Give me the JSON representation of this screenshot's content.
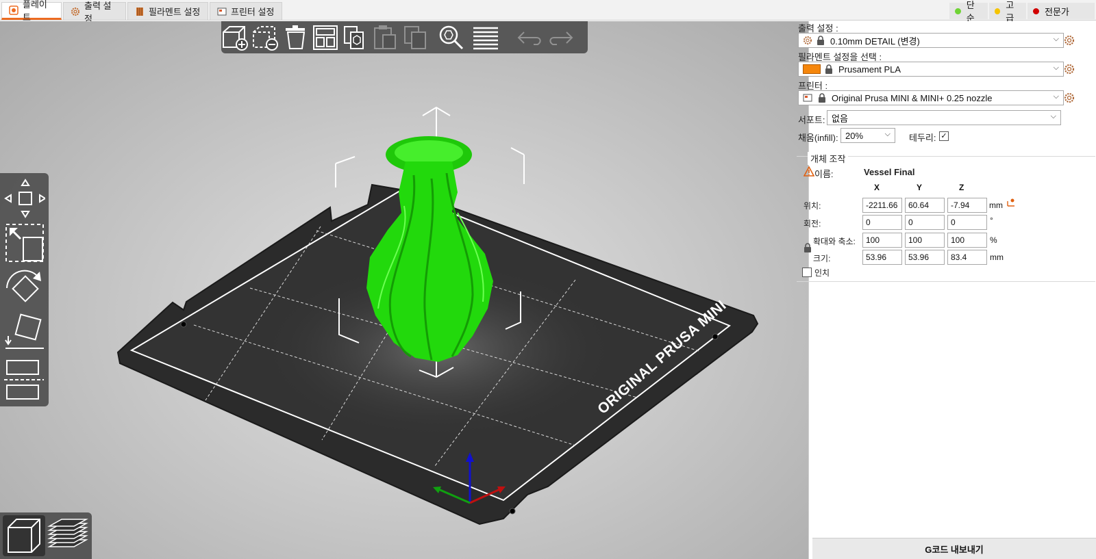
{
  "tabs": [
    {
      "label": "플레이트",
      "icon": "plater-icon"
    },
    {
      "label": "출력 설정",
      "icon": "print-settings-gear-icon"
    },
    {
      "label": "필라멘트 설정",
      "icon": "filament-spool-icon"
    },
    {
      "label": "프린터 설정",
      "icon": "printer-icon"
    }
  ],
  "modes": [
    {
      "label": "단순",
      "color": "#6fd334"
    },
    {
      "label": "고급",
      "color": "#f5c400"
    },
    {
      "label": "전문가",
      "color": "#d10000"
    }
  ],
  "bed": {
    "brand_text": "ORIGINAL PRUSA MINI"
  },
  "object": {
    "color": "#1fe00a"
  },
  "panel": {
    "print_settings_label": "출력 설정 :",
    "print_settings_value": "0.10mm DETAIL (변경)",
    "filament_label": "필라멘트 설정을 선택 :",
    "filament_value": "Prusament PLA",
    "filament_color": "#f5860b",
    "printer_label": "프린터 :",
    "printer_value": "Original Prusa MINI & MINI+ 0.25 nozzle",
    "support_label": "서포트:",
    "support_value": "없음",
    "infill_label": "채움(infill):",
    "infill_value": "20%",
    "brim_label": "테두리:",
    "brim_checked": "✓",
    "manip": {
      "section_title": "개체 조작",
      "name_label": "이름:",
      "name_value": "Vessel Final",
      "col_x": "X",
      "col_y": "Y",
      "col_z": "Z",
      "position_label": "위치:",
      "position": [
        "-2211.66",
        "60.64",
        "-7.94"
      ],
      "position_unit": "mm",
      "rotation_label": "회전:",
      "rotation": [
        "0",
        "0",
        "0"
      ],
      "rotation_unit": "°",
      "scale_label": "확대와 축소:",
      "scale": [
        "100",
        "100",
        "100"
      ],
      "scale_unit": "%",
      "size_label": "크기:",
      "size": [
        "53.96",
        "53.96",
        "83.4"
      ],
      "size_unit": "mm",
      "inches_label": "인치"
    },
    "export_label": "G코드 내보내기"
  }
}
